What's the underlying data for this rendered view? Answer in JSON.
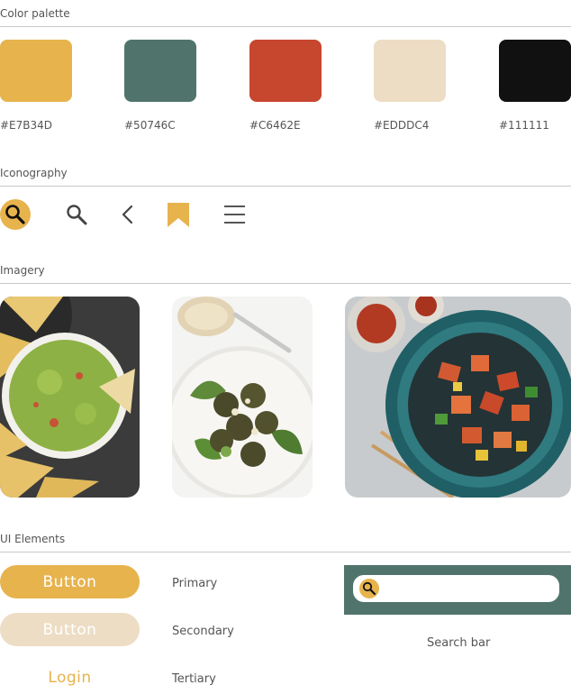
{
  "sections": {
    "color_palette": "Color palette",
    "iconography": "Iconography",
    "imagery": "Imagery",
    "ui_elements": "UI Elements"
  },
  "palette": [
    {
      "hex": "#E7B34D",
      "color": "#E7B34D"
    },
    {
      "hex": "#50746C",
      "color": "#50746C"
    },
    {
      "hex": "#C6462E",
      "color": "#C6462E"
    },
    {
      "hex": "#EDDDC4",
      "color": "#EDDDC4"
    },
    {
      "hex": "#111111",
      "color": "#111111"
    }
  ],
  "icons": [
    "search-filled-icon",
    "search-icon",
    "chevron-left-icon",
    "bookmark-icon",
    "hamburger-menu-icon"
  ],
  "images": [
    "guacamole-with-chips-photo",
    "falafel-with-sauce-photo",
    "chili-tofu-bowl-photo"
  ],
  "buttons": {
    "primary": {
      "text": "Button",
      "label": "Primary"
    },
    "secondary": {
      "text": "Button",
      "label": "Secondary"
    },
    "tertiary": {
      "text": "Login",
      "label": "Tertiary"
    }
  },
  "search": {
    "caption": "Search bar",
    "placeholder": ""
  }
}
